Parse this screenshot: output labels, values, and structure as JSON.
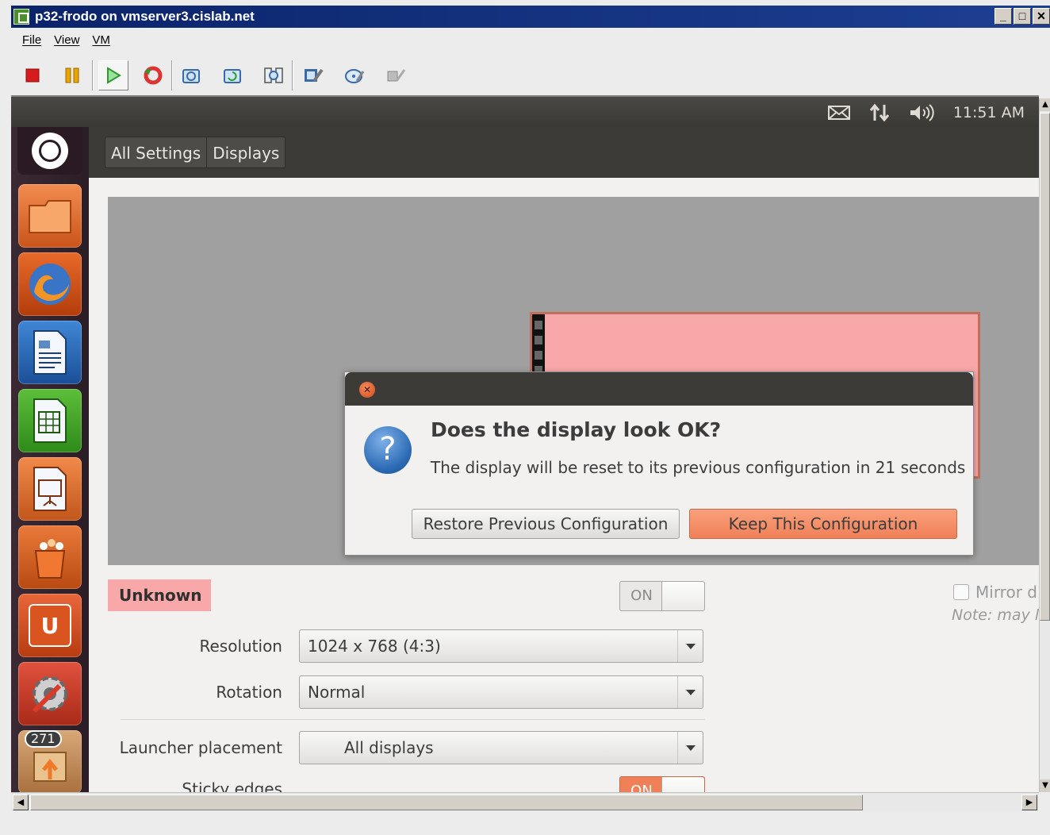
{
  "window": {
    "title": "p32-frodo on vmserver3.cislab.net",
    "buttons": [
      "_",
      "□",
      "✕"
    ]
  },
  "menu": [
    "File",
    "View",
    "VM"
  ],
  "toolbar": {
    "icons": [
      "stop-icon",
      "pause-icon",
      "play-icon",
      "reset-icon",
      "snapshot-icon",
      "revert-snapshot-icon",
      "manage-snapshots-icon",
      "vm-settings-icon",
      "cd-dvd-icon",
      "usb-icon"
    ],
    "colors": {
      "stop": "#d51b1b",
      "pause": "#e8a500",
      "play": "#2e9a2e"
    }
  },
  "topbar": {
    "time": "11:51 AM",
    "icons": [
      "mail-icon",
      "network-icon",
      "volume-icon"
    ]
  },
  "breadcrumbs": [
    "All Settings",
    "Displays"
  ],
  "launcher": {
    "icons": [
      "ubuntu-dash-icon",
      "files-icon",
      "firefox-icon",
      "writer-icon",
      "calc-icon",
      "impress-icon",
      "software-center-icon",
      "ubuntu-one-icon",
      "system-settings-icon",
      "update-manager-icon"
    ],
    "badge": "271"
  },
  "dialog": {
    "title": "Does the display look OK?",
    "message": "The display will be reset to its previous configuration in 21 seconds",
    "restore_label": "Restore Previous Configuration",
    "keep_label": "Keep This Configuration"
  },
  "display": {
    "name": "Unknown",
    "toggle_label": "ON",
    "resolution_label": "Resolution",
    "resolution_value": "1024 x 768 (4:3)",
    "rotation_label": "Rotation",
    "rotation_value": "Normal",
    "launcher_label": "Launcher placement",
    "launcher_value": "All displays",
    "sticky_label": "Sticky edges",
    "sticky_toggle": "ON",
    "mirror_label": "Mirror d",
    "note": "Note: may l"
  }
}
